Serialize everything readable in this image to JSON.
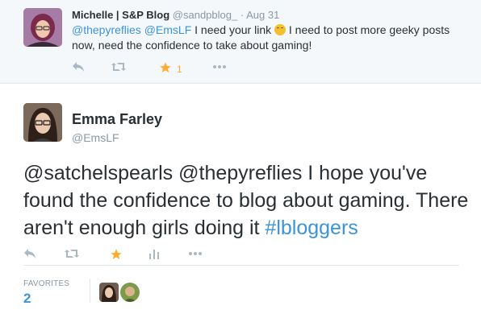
{
  "reply": {
    "name": "Michelle | S&P Blog",
    "handle": "@sandpblog_",
    "dot": "·",
    "time": "Aug 31",
    "mention1": "@thepyreflies",
    "mention2": "@EmsLF",
    "text_part1": "I need your link",
    "text_part2": "I need to post more geeky posts now, need the confidence to take about gaming!",
    "favorite_count": "1",
    "icons": [
      "reply-icon",
      "retweet-icon",
      "star-icon",
      "more-icon"
    ],
    "star_color": "#ffac33"
  },
  "tweet": {
    "name": "Emma Farley",
    "handle": "@EmsLF",
    "text": "@satchelspearls @thepyreflies I hope you've found the confidence to blog about gaming. There aren't enough girls doing it",
    "hashtag": "#lbloggers",
    "icons": [
      "reply-icon",
      "retweet-icon",
      "star-icon",
      "stats-icon",
      "more-icon"
    ]
  },
  "stats": {
    "favorites_label": "FAVORITES",
    "favorites_count": "2"
  },
  "colors": {
    "link": "#3b94d9",
    "muted": "#8899a6",
    "text": "#292f33",
    "reply_bg": "#f5f8fa"
  }
}
